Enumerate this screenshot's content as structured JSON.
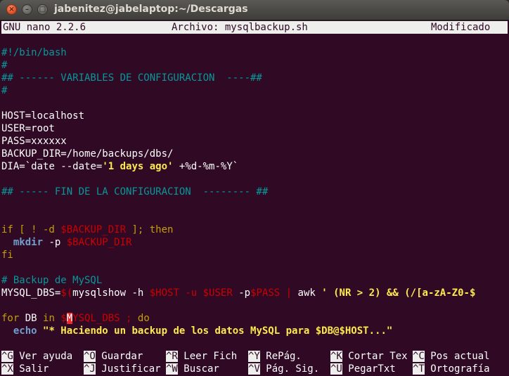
{
  "window": {
    "title": "jabenitez@jabelaptop:~/Descargas"
  },
  "nano": {
    "version": "GNU nano 2.2.6",
    "file": "Archivo: mysqlbackup.sh",
    "status": "Modificado"
  },
  "code": {
    "l1": "#!/bin/bash",
    "l2": "#",
    "l3": "## ------ VARIABLES DE CONFIGURACION  ----##",
    "l4": "#",
    "l6a": "HOST",
    "l6b": "=localhost",
    "l7a": "USER",
    "l7b": "=root",
    "l8a": "PASS",
    "l8b": "=xxxxxx",
    "l9a": "BACKUP_DIR",
    "l9b": "=/home/backups/dbs/",
    "l10a": "DIA",
    "l10b": "=`date --date=",
    "l10c": "'1 days ago'",
    "l10d": " +%d-%m-%Y`",
    "l12": "## ----- FIN DE LA CONFIGURACION  -------- ##",
    "l15a": "if",
    "l15b": " [ ! -d ",
    "l15c": "$BACKUP_DIR",
    "l15d": " ]; ",
    "l15e": "then",
    "l16a": "  ",
    "l16b": "mkdir",
    "l16c": " -p ",
    "l16d": "$BACKUP_DIR",
    "l17": "fi",
    "l19": "# Backup de MySQL",
    "l20a": "MYSQL_DBS=",
    "l20b": "$(",
    "l20c": "mysqlshow -h ",
    "l20d": "$HOST",
    "l20e": " -u ",
    "l20f": "$USER",
    "l20g": " -p",
    "l20h": "$PASS",
    "l20i": " | ",
    "l20j": "awk ",
    "l20k": "' (NR > 2) && (/[a-zA-Z0-$",
    "l22a": "for",
    "l22b": " DB ",
    "l22c": "in",
    "l22d": " $",
    "l22e": "M",
    "l22f": "YSQL_DBS",
    "l22g": " ; ",
    "l22h": "do",
    "l23a": "  ",
    "l23b": "echo",
    "l23c": " ",
    "l23d": "\"* Haciendo un backup de los datos MySQL para $DB@$HOST...\""
  },
  "shortcuts": [
    {
      "key": "^G",
      "label": " Ver ayuda"
    },
    {
      "key": "^O",
      "label": " Guardar"
    },
    {
      "key": "^R",
      "label": " Leer Fich"
    },
    {
      "key": "^Y",
      "label": " RePág."
    },
    {
      "key": "^K",
      "label": " Cortar Tex"
    },
    {
      "key": "^C",
      "label": " Pos actual"
    },
    {
      "key": "^X",
      "label": " Salir"
    },
    {
      "key": "^J",
      "label": " Justificar"
    },
    {
      "key": "^W",
      "label": " Buscar"
    },
    {
      "key": "^V",
      "label": " Pág. Sig."
    },
    {
      "key": "^U",
      "label": " PegarTxt"
    },
    {
      "key": "^T",
      "label": " Ortografía"
    }
  ]
}
